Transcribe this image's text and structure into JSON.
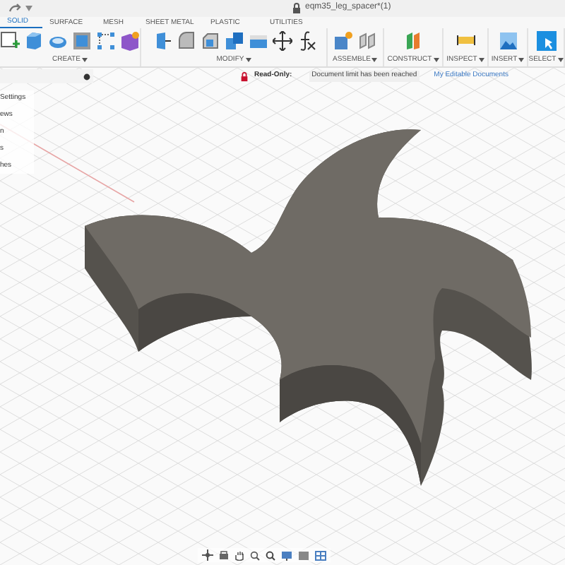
{
  "title_bar": {
    "title": "eqm35_leg_spacer*(1)"
  },
  "tabs": [
    {
      "label": "SOLID",
      "selected": true
    },
    {
      "label": "SURFACE",
      "selected": false
    },
    {
      "label": "MESH",
      "selected": false
    },
    {
      "label": "SHEET METAL",
      "selected": false
    },
    {
      "label": "PLASTIC",
      "selected": false
    },
    {
      "label": "UTILITIES",
      "selected": false
    }
  ],
  "tool_groups": [
    {
      "label": "CREATE"
    },
    {
      "label": "MODIFY"
    },
    {
      "label": "ASSEMBLE"
    },
    {
      "label": "CONSTRUCT"
    },
    {
      "label": "INSPECT"
    },
    {
      "label": "INSERT"
    },
    {
      "label": "SELECT"
    }
  ],
  "notice": {
    "badge": "Read-Only:",
    "message": "Document limit has been reached",
    "link": "My Editable Documents"
  },
  "browser": {
    "items": [
      "Settings",
      "ews",
      "n",
      "s",
      "hes"
    ]
  }
}
